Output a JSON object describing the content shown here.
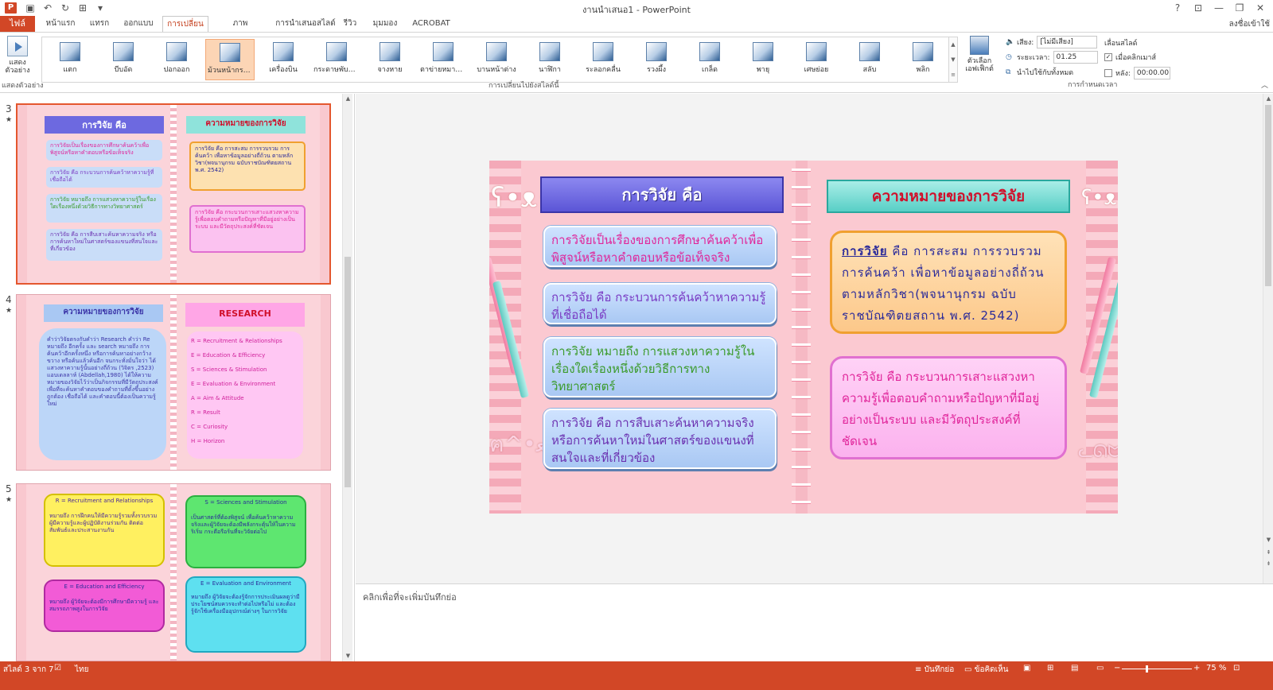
{
  "window": {
    "title": "งานนำเสนอ1 - PowerPoint",
    "signin": "ลงชื่อเข้าใช้"
  },
  "tabs": [
    "ไฟล์",
    "หน้าแรก",
    "แทรก",
    "ออกแบบ",
    "การเปลี่ยน",
    "ภาพเคลื่อนไหว",
    "การนำเสนอสไลด์",
    "รีวิว",
    "มุมมอง",
    "ACROBAT"
  ],
  "active_tab_index": 4,
  "ribbon": {
    "preview_label": "แสดงตัวอย่าง",
    "preview_group": "แสดงตัวอย่าง",
    "transitions_group": "การเปลี่ยนไปยังสไลด์นี้",
    "timing_group": "การกำหนดเวลา",
    "effect_options": "ตัวเลือกเอฟเฟ็กต์",
    "transitions": [
      "แตก",
      "บีบอัด",
      "ปอกออก",
      "ม้วนหน้ากระด...",
      "เครื่องบิน",
      "กระดาษพับญี่...",
      "จางหาย",
      "ตาข่ายหมากรุก",
      "บานหน้าต่าง",
      "นาฬิกา",
      "ระลอกคลื่น",
      "รวงผึ้ง",
      "เกล็ด",
      "พายุ",
      "เศษย่อย",
      "สลับ",
      "พลิก"
    ],
    "selected_transition": 3,
    "timing": {
      "sound_label": "เสียง:",
      "sound_value": "[ไม่มีเสียง]",
      "duration_label": "ระยะเวลา:",
      "duration_value": "01.25",
      "apply_all": "นำไปใช้กับทั้งหมด",
      "advance_label": "เลื่อนสไลด์",
      "on_click": "เมื่อคลิกเมาส์",
      "on_click_checked": true,
      "after_label": "หลัง:",
      "after_value": "00:00.00",
      "after_checked": false
    }
  },
  "thumbnails": [
    {
      "number": "3",
      "left_title": "การวิจัย คือ",
      "right_title": "ความหมายของการวิจัย",
      "left_items": [
        "การวิจัยเป็นเรื่องของการศึกษาค้นคว้าเพื่อพิสูจน์หรือหาคำตอบหรือข้อเท็จจริง",
        "การวิจัย คือ กระบวนการค้นคว้าหาความรู้ที่เชื่อถือได้",
        "การวิจัย หมายถึง การแสวงหาความรู้ในเรื่องใดเรื่องหนึ่งด้วยวิธีการทางวิทยาศาสตร์",
        "การวิจัย คือ การสืบเสาะค้นหาความจริง หรือการค้นหาใหม่ในศาสตร์ของแขนงที่สนใจและที่เกี่ยวข้อง"
      ],
      "right_items": [
        "การวิจัย คือ การสะสม การรวบรวม การค้นคว้า เพื่อหาข้อมูลอย่างถี่ถ้วน ตามหลักวิชา(พจนานุกรม ฉบับราชบัณฑิตยสถาน พ.ศ. 2542)",
        "การวิจัย คือ กระบวนการเสาะแสวงหาความรู้เพื่อตอบคำถามหรือปัญหาที่มีอยู่อย่างเป็นระบบ และมีวัตถุประสงค์ที่ชัดเจน"
      ]
    },
    {
      "number": "4",
      "left_title": "ความหมายของการวิจัย",
      "right_title": "RESEARCH",
      "left_text": "คำว่าวิจัยตรงกับคำว่า Research คำว่า Re หมายถึง อีกครั้ง และ search หมายถึง การค้นคว้าอีกครั้งหนึ่ง หรือการค้นหาอย่างกว้างขวาง หรือค้นแล้วค้นอีก จนกระทั่งมั่นใจว่า ได้แสวงหาความรู้นั้นอย่างถี่ถ้วน (วิจิตร ,2523) แอบเดลลาห์ (Abdellah,1980) ได้ให้ความหมายของวิจัยไว้ว่าเป็นกิจกรรมที่มีวัตถุประสงค์เพื่อที่จะค้นหาคำตอบของคำถามที่ตั้งขึ้นอย่างถูกต้อง เชื่อถือได้ และคำตอบนี้ต้องเป็นความรู้ใหม่",
      "right_items": [
        "R = Recruitment & Relationships",
        "E = Education & Efficiency",
        "S = Sciences & Stimulation",
        "E = Evaluation & Environment",
        "A = Aim & Attitude",
        "R = Result",
        "C = Curiosity",
        "H = Horizon"
      ]
    },
    {
      "number": "5",
      "boxes": [
        {
          "title": "R = Recruitment and Relationships",
          "text": "หมายถึง การฝึกคนให้มีความรู้รวมทั้งรวบรวมผู้มีความรู้และผู้ปฏิบัติงานร่วมกัน ติดต่อสัมพันธ์และประสานงานกัน"
        },
        {
          "title": "S = Sciences and Stimulation",
          "text": "เป็นศาสตร์ที่ต้องพิสูจน์ เพื่อค้นคว้าหาความจริงและผู้วิจัยจะต้องมีพลังกระตุ้นให้ในความริเริ่ม กระตือรือร้นที่จะวิจัยต่อไป"
        },
        {
          "title": "E = Education and Efficiency",
          "text": "หมายถึง ผู้วิจัยจะต้องมีการศึกษามีความรู้ และสมรรถภาพสูงในการวิจัย"
        },
        {
          "title": "E = Evaluation and Environment",
          "text": "หมายถึง ผู้วิจัยจะต้องรู้จักการประเมินผลดูว่ามีประโยชน์สมควรจะทำต่อไปหรือไม่ และต้องรู้จักใช้เครื่องมืออุปกรณ์ต่างๆ ในการวิจัย"
        }
      ]
    }
  ],
  "slide": {
    "left_title": "การวิจัย คือ",
    "right_title": "ความหมายของการวิจัย",
    "left_items": [
      {
        "text": "การวิจัยเป็นเรื่องของการศึกษาค้นคว้าเพื่อพิสูจน์หรือหาคำตอบหรือข้อเท็จจริง",
        "color": "#e0259a"
      },
      {
        "text": "การวิจัย คือ กระบวนการค้นคว้าหาความรู้ที่เชื่อถือได้",
        "color": "#7a3cc4"
      },
      {
        "text": "การวิจัย หมายถึง การแสวงหาความรู้ในเรื่องใดเรื่องหนึ่งด้วยวิธีการทางวิทยาศาสตร์",
        "color": "#3a9a2a"
      },
      {
        "text": "การวิจัย คือ การสืบเสาะค้นหาความจริง หรือการค้นหาใหม่ในศาสตร์ของแขนงที่สนใจและที่เกี่ยวข้อง",
        "color": "#6a30b0"
      }
    ],
    "right_box1_keyword": "การวิจัย",
    "right_box1_text": " คือ การสะสม การรวบรวม การค้นคว้า เพื่อหาข้อมูลอย่างถี่ถ้วน ตามหลักวิชา(พจนานุกรม ฉบับราชบัณฑิตยสถาน พ.ศ. 2542)",
    "right_box2_text": "การวิจัย คือ กระบวนการเสาะแสวงหาความรู้เพื่อตอบคำถามหรือปัญหาที่มีอยู่อย่างเป็นระบบ และมีวัตถุประสงค์ที่ชัดเจน"
  },
  "notes_placeholder": "คลิกเพื่อที่จะเพิ่มบันทึกย่อ",
  "status": {
    "slide_of": "สไลด์ 3 จาก 7",
    "language": "ไทย",
    "notes_btn": "บันทึกย่อ",
    "comments_btn": "ข้อคิดเห็น",
    "zoom": "75 %"
  }
}
